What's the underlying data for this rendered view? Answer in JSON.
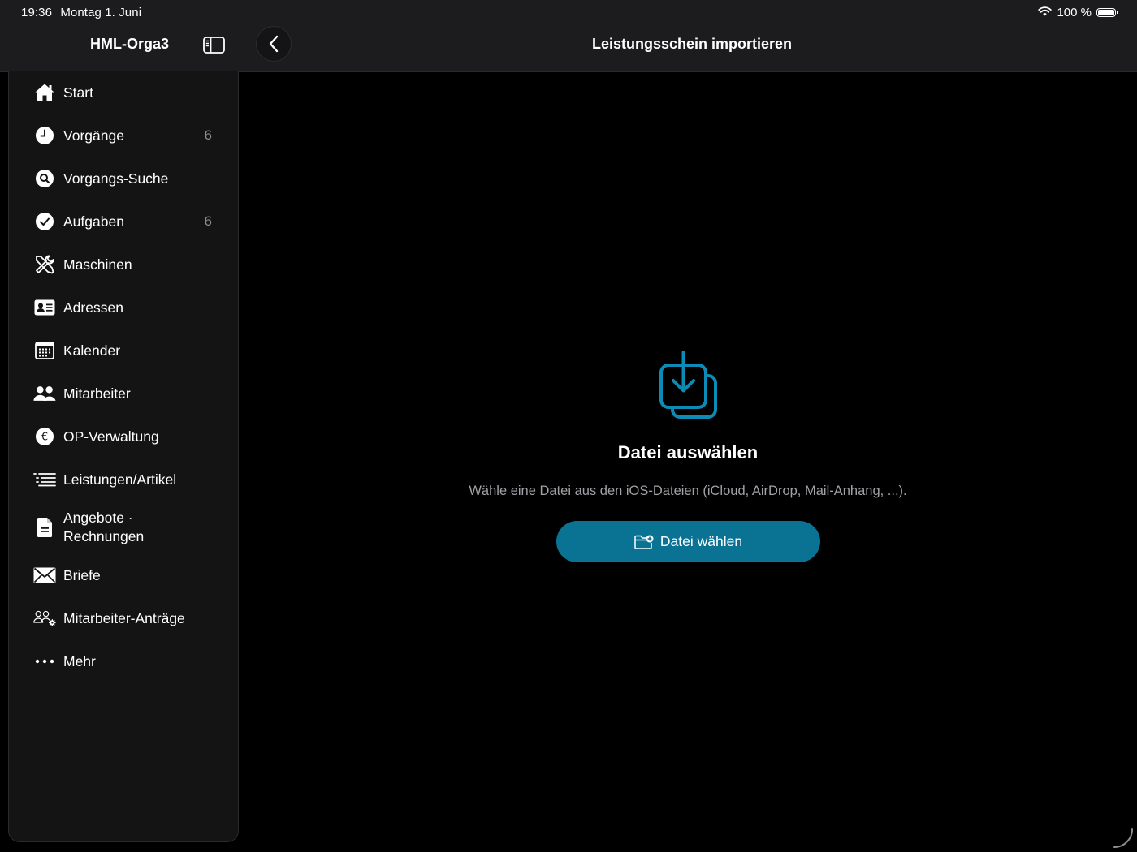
{
  "status_bar": {
    "time": "19:36",
    "date": "Montag 1. Juni",
    "battery_text": "100 %",
    "battery_level": 1.0,
    "icons": [
      "wifi-icon",
      "battery-icon"
    ]
  },
  "sidebar": {
    "title": "HML-Orga3",
    "toggle_icon": "sidebar-toggle-icon",
    "items": [
      {
        "label": "Start",
        "icon": "house-icon",
        "count": ""
      },
      {
        "label": "Vorgänge",
        "icon": "clock-icon",
        "count": "6"
      },
      {
        "label": "Vorgangs-Suche",
        "icon": "magnifier-circle-icon",
        "count": ""
      },
      {
        "label": "Aufgaben",
        "icon": "checkmark-circle-icon",
        "count": "6"
      },
      {
        "label": "Maschinen",
        "icon": "tools-icon",
        "count": ""
      },
      {
        "label": "Adressen",
        "icon": "contact-card-icon",
        "count": ""
      },
      {
        "label": "Kalender",
        "icon": "calendar-icon",
        "count": ""
      },
      {
        "label": "Mitarbeiter",
        "icon": "people-icon",
        "count": ""
      },
      {
        "label": "OP-Verwaltung",
        "icon": "euro-circle-icon",
        "count": ""
      },
      {
        "label": "Leistungen/Artikel",
        "icon": "list-indent-icon",
        "count": ""
      },
      {
        "label_line1": "Angebote ·",
        "label_line2": "Rechnungen",
        "icon": "document-icon",
        "count": ""
      },
      {
        "label": "Briefe",
        "icon": "envelope-icon",
        "count": ""
      },
      {
        "label": "Mitarbeiter-Anträge",
        "icon": "people-gear-icon",
        "count": ""
      },
      {
        "label": "Mehr",
        "icon": "ellipsis-icon",
        "count": ""
      }
    ]
  },
  "header": {
    "title": "Leistungsschein importieren",
    "back_icon": "chevron-left-icon"
  },
  "main": {
    "icon": "import-tray-icon",
    "heading": "Datei auswählen",
    "description": "Wähle eine Datei aus den iOS-Dateien (iCloud, AirDrop, Mail-Anhang, ...).",
    "button_label": "Datei wählen",
    "button_icon": "folder-add-icon"
  },
  "colors": {
    "accent": "#0a7394",
    "icon_accent": "#0b8bb5",
    "background": "#000000",
    "bar_background": "#1c1c1e",
    "sidebar_background": "#141414",
    "secondary_text": "#a1a1a6"
  }
}
